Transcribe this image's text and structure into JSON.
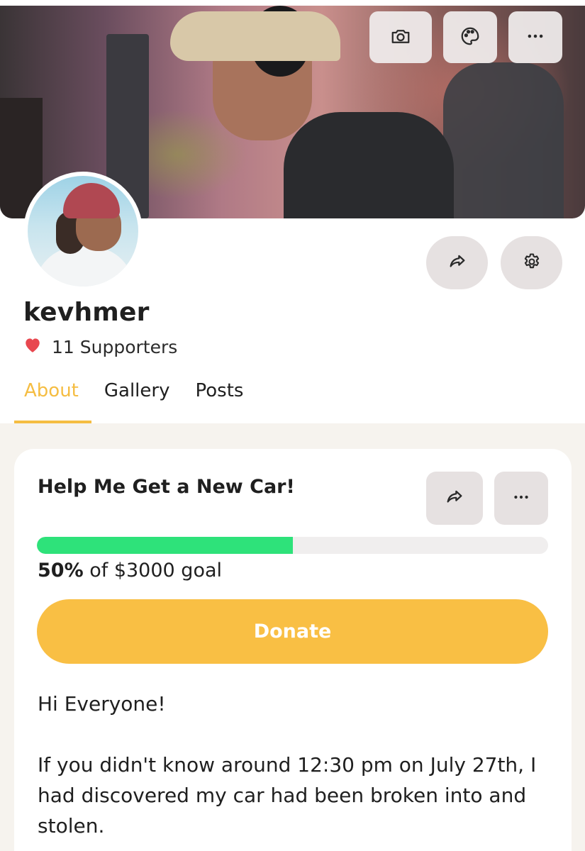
{
  "profile": {
    "username": "kevhmer",
    "supporters_label": "11 Supporters"
  },
  "cover_actions": [
    "camera-icon",
    "palette-icon",
    "more-icon"
  ],
  "profile_actions": [
    "share-icon",
    "gear-icon"
  ],
  "tabs": [
    {
      "label": "About",
      "active": true
    },
    {
      "label": "Gallery",
      "active": false
    },
    {
      "label": "Posts",
      "active": false
    }
  ],
  "fundraiser": {
    "title": "Help Me Get a New Car!",
    "progress_percent": 50,
    "percent_label": "50%",
    "goal_label": " of $3000 goal",
    "donate_label": "Donate",
    "body": [
      "Hi Everyone!",
      "If you didn't know around 12:30 pm on July 27th, I had discovered my car had been broken into and stolen."
    ]
  },
  "colors": {
    "accent": "#f5bd42",
    "donate": "#f9bf44",
    "progress": "#2ee27a",
    "heart": "#e8474f",
    "content_bg": "#f6f3ee"
  }
}
